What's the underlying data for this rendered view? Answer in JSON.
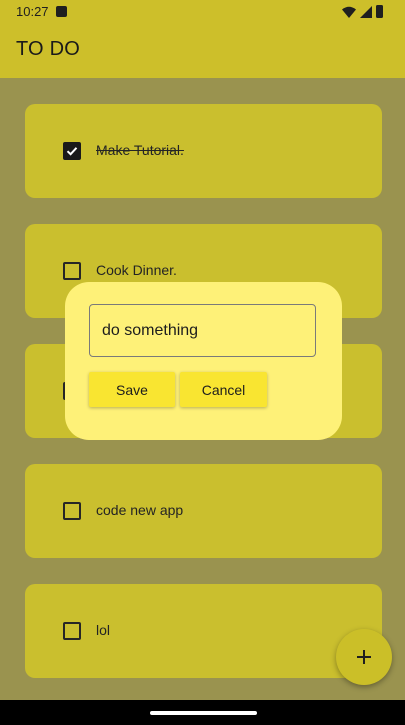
{
  "status_bar": {
    "time": "10:27"
  },
  "app_bar": {
    "title": "TO DO"
  },
  "tasks": [
    {
      "label": "Make Tutorial.",
      "done": true
    },
    {
      "label": "Cook Dinner.",
      "done": false
    },
    {
      "label": "",
      "done": false
    },
    {
      "label": "code new app",
      "done": false
    },
    {
      "label": "lol",
      "done": false
    }
  ],
  "dialog": {
    "input_value": "do something",
    "save_label": "Save",
    "cancel_label": "Cancel"
  },
  "fab": {
    "icon": "plus-icon"
  },
  "colors": {
    "app_bar": "#cdbf2a",
    "card": "#cabf2e",
    "dialog": "#fef178",
    "button": "#f9e531"
  }
}
